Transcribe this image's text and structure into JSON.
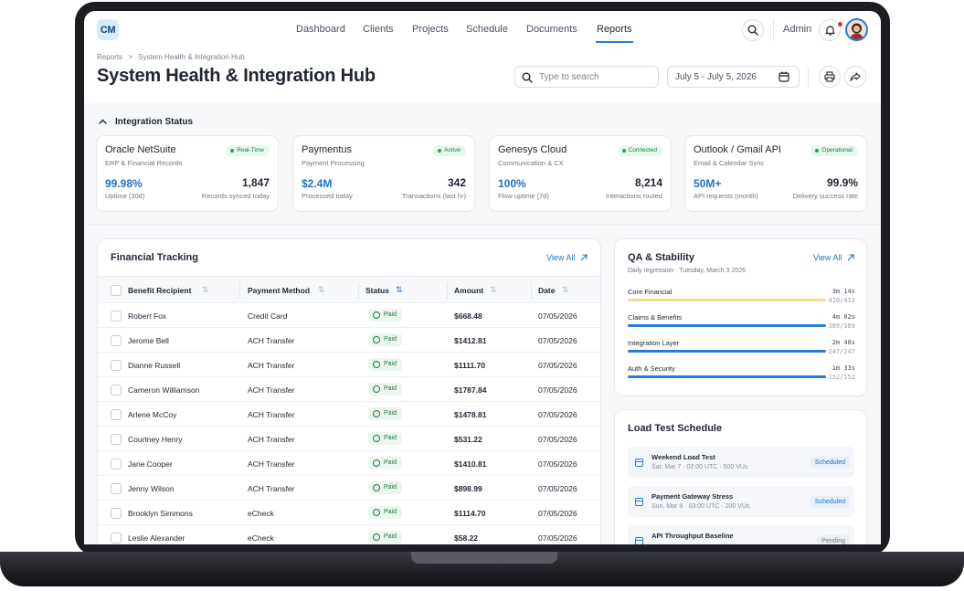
{
  "app": {
    "logo": "CM"
  },
  "nav": {
    "links": [
      "Dashboard",
      "Clients",
      "Projects",
      "Schedule",
      "Documents",
      "Reports"
    ],
    "active": "Reports",
    "admin_label": "Admin"
  },
  "header": {
    "breadcrumb_root": "Reports",
    "breadcrumb_sep": ">",
    "breadcrumb_current": "System Health & Integration Hub",
    "title": "System Health & Integration Hub",
    "search_placeholder": "Type to search",
    "date_range": "July 5 - July 5, 2026"
  },
  "integration": {
    "section_title": "Integration Status",
    "cards": [
      {
        "name": "Oracle NetSuite",
        "sub": "ERP & Financial Records",
        "status": "Real-Time",
        "left_value": "99.98%",
        "left_label": "Uptime (30d)",
        "right_value": "1,847",
        "right_label": "Records synced today"
      },
      {
        "name": "Paymentus",
        "sub": "Payment Processing",
        "status": "Active",
        "left_value": "$2.4M",
        "left_label": "Processed today",
        "right_value": "342",
        "right_label": "Transactions (last hr)"
      },
      {
        "name": "Genesys Cloud",
        "sub": "Communication & CX",
        "status": "Connected",
        "left_value": "100%",
        "left_label": "Flow uptime (7d)",
        "right_value": "8,214",
        "right_label": "Interactions routed"
      },
      {
        "name": "Outlook / Gmail API",
        "sub": "Email & Calendar Sync",
        "status": "Operational",
        "left_value": "50M+",
        "left_label": "API requests (month)",
        "right_value": "99.9%",
        "right_label": "Delivery success rate"
      }
    ]
  },
  "financial": {
    "title": "Financial Tracking",
    "view_all": "View All",
    "columns": [
      "Benefit Recipient",
      "Payment Method",
      "Status",
      "Amount",
      "Date"
    ],
    "rows": [
      {
        "recipient": "Robert Fox",
        "method": "Credit Card",
        "status": "Paid",
        "amount": "$668.48",
        "date": "07/05/2026"
      },
      {
        "recipient": "Jerome Bell",
        "method": "ACH Transfer",
        "status": "Paid",
        "amount": "$1412.81",
        "date": "07/05/2026"
      },
      {
        "recipient": "Dianne Russell",
        "method": "ACH Transfer",
        "status": "Paid",
        "amount": "$1111.70",
        "date": "07/05/2026"
      },
      {
        "recipient": "Cameron Williamson",
        "method": "ACH Transfer",
        "status": "Paid",
        "amount": "$1787.84",
        "date": "07/05/2026"
      },
      {
        "recipient": "Arlene McCoy",
        "method": "ACH Transfer",
        "status": "Paid",
        "amount": "$1478.81",
        "date": "07/05/2026"
      },
      {
        "recipient": "Courtney Henry",
        "method": "ACH Transfer",
        "status": "Paid",
        "amount": "$531.22",
        "date": "07/05/2026"
      },
      {
        "recipient": "Jane Cooper",
        "method": "ACH Transfer",
        "status": "Paid",
        "amount": "$1410.81",
        "date": "07/05/2026"
      },
      {
        "recipient": "Jenny Wilson",
        "method": "ACH Transfer",
        "status": "Paid",
        "amount": "$898.99",
        "date": "07/05/2026"
      },
      {
        "recipient": "Brooklyn Simmons",
        "method": "eCheck",
        "status": "Paid",
        "amount": "$1114.70",
        "date": "07/05/2026"
      },
      {
        "recipient": "Leslie Alexander",
        "method": "eCheck",
        "status": "Paid",
        "amount": "$58.22",
        "date": "07/05/2026"
      }
    ]
  },
  "qa": {
    "title": "QA & Stability",
    "view_all": "View All",
    "subtitle": "Daily regression · Tuesday, March 3 2026",
    "items": [
      {
        "name": "Core Financial",
        "time": "3m 14s",
        "count": "410/412",
        "progress": 0.995,
        "color": "#f0dc8f"
      },
      {
        "name": "Claims & Benefits",
        "time": "4m 02s",
        "count": "389/389",
        "progress": 1.0,
        "color": "#2a7bd5"
      },
      {
        "name": "Integration Layer",
        "time": "2m 48s",
        "count": "247/247",
        "progress": 1.0,
        "color": "#2a7bd5"
      },
      {
        "name": "Auth & Security",
        "time": "1m 33s",
        "count": "152/152",
        "progress": 1.0,
        "color": "#2a7bd5"
      }
    ]
  },
  "load_tests": {
    "title": "Load Test Schedule",
    "items": [
      {
        "name": "Weekend Load Test",
        "meta": "Sat, Mar 7 · 02:00 UTC · 500 VUs",
        "status": "Scheduled"
      },
      {
        "name": "Payment Gateway Stress",
        "meta": "Sun, Mar 8 · 03:00 UTC · 200 VUs",
        "status": "Scheduled"
      },
      {
        "name": "API Throughput Baseline",
        "meta": "",
        "status": "Pending"
      }
    ]
  },
  "colors": {
    "accent": "#2a7bd5",
    "success": "#22a35a",
    "warning": "#f0dc8f"
  }
}
